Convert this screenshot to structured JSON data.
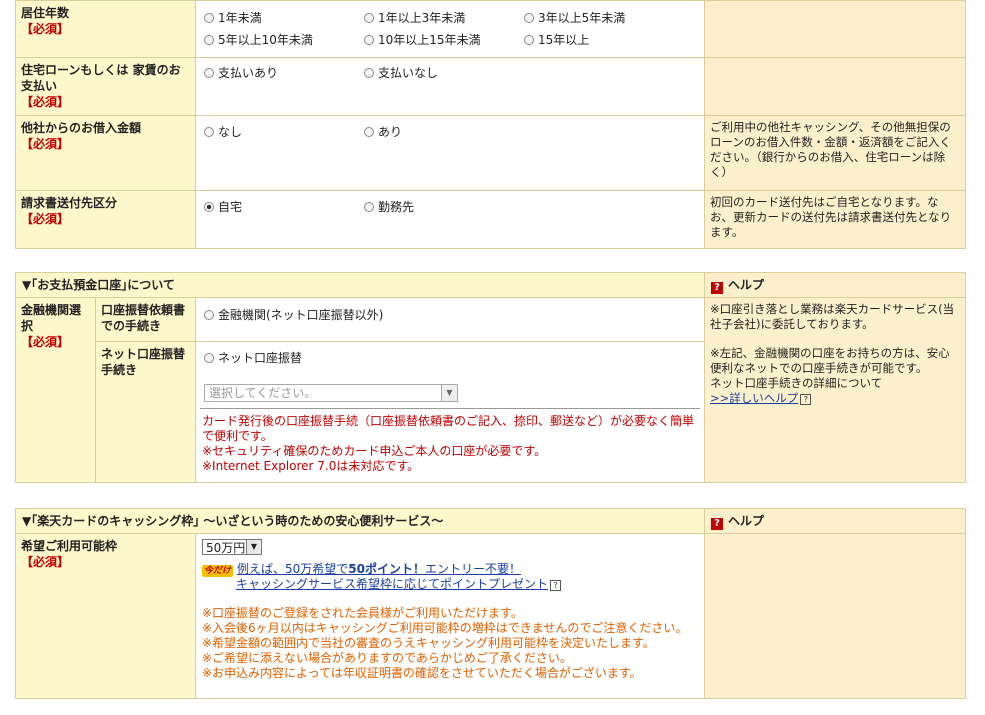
{
  "residence": {
    "label": "居住年数",
    "required": "【必須】",
    "options": [
      "1年未満",
      "1年以上3年未満",
      "3年以上5年未満",
      "5年以上10年未満",
      "10年以上15年未満",
      "15年以上"
    ]
  },
  "housing": {
    "label": "住宅ローンもしくは 家賃のお支払い",
    "required": "【必須】",
    "options": [
      "支払いあり",
      "支払いなし"
    ]
  },
  "other_loans": {
    "label": "他社からのお借入金額",
    "required": "【必須】",
    "options": [
      "なし",
      "あり"
    ],
    "help": "ご利用中の他社キャッシング、その他無担保のローンのお借入件数・金額・返済額をご記入ください。（銀行からのお借入、住宅ローンは除く）"
  },
  "billing": {
    "label": "請求書送付先区分",
    "required": "【必須】",
    "options": [
      "自宅",
      "勤務先"
    ],
    "selected": "自宅",
    "help": "初回のカード送付先はご自宅となります。なお、更新カードの送付先は請求書送付先となります。"
  },
  "bank_section": {
    "title": "▼｢お支払預金口座｣について",
    "help_title": "ヘルプ",
    "label": "金融機関選択",
    "required": "【必須】",
    "sub1_label": "口座振替依頼書での手続き",
    "sub1_option": "金融機関(ネット口座振替以外)",
    "sub2_label": "ネット口座振替手続き",
    "sub2_option": "ネット口座振替",
    "select_placeholder": "選択してください。",
    "note1": "カード発行後の口座振替手続（口座振替依頼書のご記入、捺印、郵送など）が必要なく簡単で便利です。",
    "note2": "※セキュリティ確保のためカード申込ご本人の口座が必要です。",
    "note3": "※Internet Explorer 7.0は未対応です。",
    "help1": "※口座引き落とし業務は楽天カードサービス(当社子会社)に委託しております。",
    "help2": "※左記、金融機関の口座をお持ちの方は、安心便利なネットでの口座手続きが可能です。",
    "help3": "ネット口座手続きの詳細について",
    "help_link": ">>詳しいヘルプ"
  },
  "cashing_section": {
    "title": "▼｢楽天カードのキャッシング枠｣ ～いざという時のための安心便利サービス～",
    "help_title": "ヘルプ",
    "label": "希望ご利用可能枠",
    "required": "【必須】",
    "selected_amount": "50万円",
    "badge": "今だけ",
    "promo_prefix": "例えば、50万希望で",
    "promo_points": "50ポイント！",
    "promo_suffix": "エントリー不要！",
    "promo_line2": "キャッシングサービス希望枠に応じてポイントプレゼント",
    "notes": [
      "※口座振替のご登録をされた会員様がご利用いただけます。",
      "※入会後6ヶ月以内はキャッシングご利用可能枠の増枠はできませんのでご注意ください。",
      "※希望金額の範囲内で当社の審査のうえキャッシング利用可能枠を決定いたします。",
      "※ご希望に添えない場合がありますのであらかじめご了承ください。",
      "※お申込み内容によっては年収証明書の確認をさせていただく場合がございます。"
    ]
  },
  "colors": {
    "label_bg": "#fdf7cc",
    "help_bg": "#fcf0cc",
    "required": "#c00000",
    "note_orange": "#e06000",
    "link": "#1a3fa0"
  }
}
